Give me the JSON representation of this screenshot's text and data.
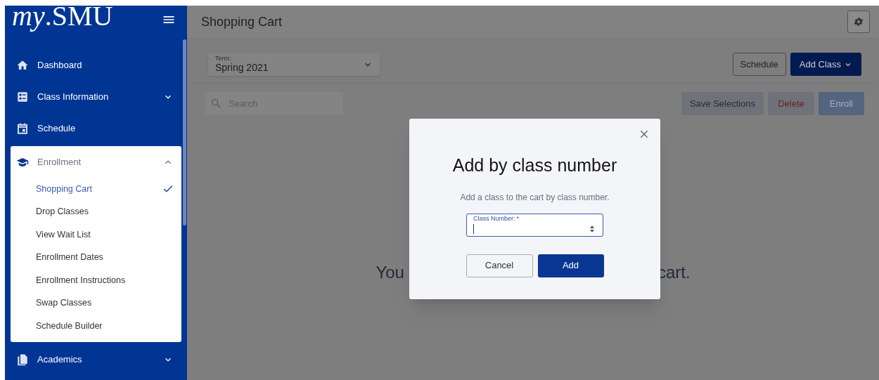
{
  "sidebar": {
    "logo": "*my*.SMU",
    "items": [
      {
        "label": "Dashboard"
      },
      {
        "label": "Class Information",
        "expanded": false
      },
      {
        "label": "Schedule"
      },
      {
        "label": "Enrollment",
        "expanded": true,
        "children": [
          {
            "label": "Shopping Cart",
            "selected": true
          },
          {
            "label": "Drop Classes",
            "selected": false
          },
          {
            "label": "View Wait List",
            "selected": false
          },
          {
            "label": "Enrollment Dates",
            "selected": false
          },
          {
            "label": "Enrollment Instructions",
            "selected": false
          },
          {
            "label": "Swap Classes",
            "selected": false
          },
          {
            "label": "Schedule Builder",
            "selected": false
          }
        ]
      },
      {
        "label": "Academics",
        "expanded": false
      }
    ]
  },
  "header": {
    "title": "Shopping Cart"
  },
  "term": {
    "label": "Term:",
    "value": "Spring 2021"
  },
  "toolbar": {
    "schedule_button": "Schedule",
    "add_class_button": "Add Class"
  },
  "search": {
    "placeholder": "Search"
  },
  "actions": [
    "Save Selections",
    "Delete",
    "Enroll"
  ],
  "empty_message": {
    "left": "You",
    "right": "cart."
  },
  "dialog": {
    "title": "Add by class number",
    "subtitle": "Add a class to the cart by class number.",
    "field_label": "Class Number:",
    "required_mark": "*",
    "buttons": [
      "Cancel",
      "Add"
    ]
  }
}
